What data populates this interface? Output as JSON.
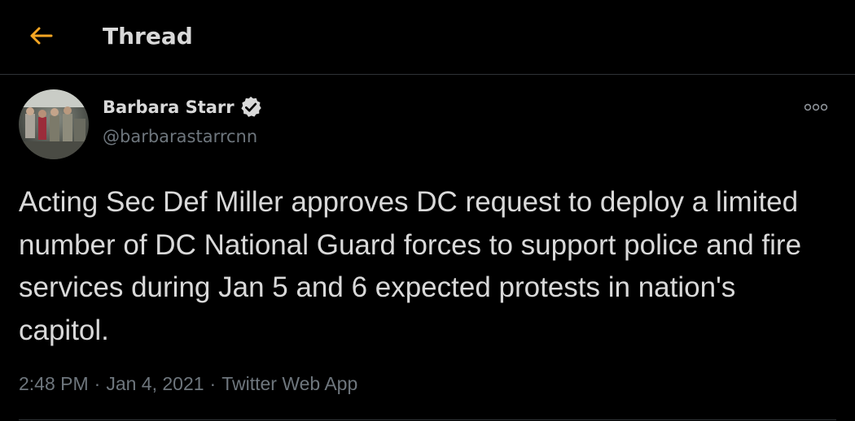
{
  "header": {
    "title": "Thread",
    "back_icon": "arrow-left-icon"
  },
  "tweet": {
    "author_name": "Barbara Starr",
    "author_handle": "@barbarastarrcnn",
    "verified_icon": "verified-badge-icon",
    "more_icon": "more-options-icon",
    "text": "Acting Sec Def Miller approves DC request to deploy a limited number of DC National Guard forces to support police and fire services during Jan 5 and 6 expected protests in nation's capitol.",
    "time": "2:48 PM",
    "date": "Jan 4, 2021",
    "source": "Twitter Web App",
    "separator": "·"
  },
  "colors": {
    "background": "#000000",
    "accent": "#f5a623",
    "text_primary": "#d9d9d9",
    "text_secondary": "#6e767d",
    "divider": "#2f3336"
  }
}
